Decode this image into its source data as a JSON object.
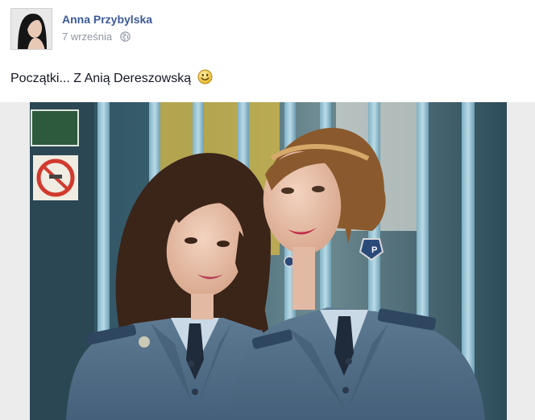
{
  "post": {
    "author": "Anna Przybylska",
    "date": "7 września",
    "privacy_icon": "globe-icon",
    "text": "Początki... Z Anią Dereszowską",
    "emoji": "smiley-emoji"
  },
  "photo": {
    "subject": "two women in police uniforms",
    "badge_letter": "P"
  },
  "colors": {
    "author_link": "#3b5998",
    "meta_text": "#9197a3",
    "uniform": "#4f6a82"
  }
}
